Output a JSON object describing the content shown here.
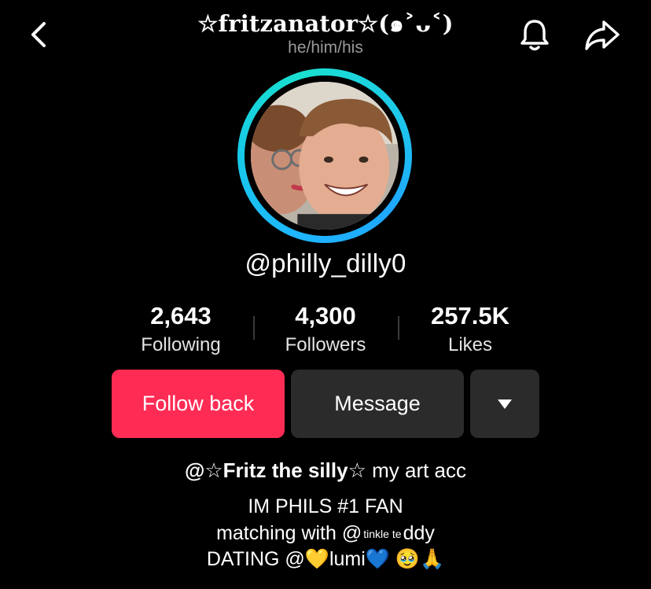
{
  "header": {
    "display_name": "☆fritzanator☆(๑˃ᴗ˂)",
    "pronouns": "he/him/his",
    "back_icon": "chevron-left-icon",
    "bell_icon": "bell-icon",
    "share_icon": "share-arrow-icon"
  },
  "profile": {
    "username": "@philly_dilly0",
    "avatar_ring_colors": [
      "#1fb6ff",
      "#19e0d0"
    ]
  },
  "stats": [
    {
      "value": "2,643",
      "label": "Following"
    },
    {
      "value": "4,300",
      "label": "Followers"
    },
    {
      "value": "257.5K",
      "label": "Likes"
    }
  ],
  "actions": {
    "follow_back": "Follow back",
    "message": "Message",
    "more_icon": "triangle-down-icon",
    "follow_color": "#fe2c55",
    "secondary_color": "#2b2b2b"
  },
  "bio": {
    "line1_mention": "@☆Fritz the silly☆",
    "line1_rest": " my art acc",
    "line2": "IM PHILS #1 FAN",
    "line3_prefix": "matching with @",
    "line3_tiny1": "tinkle",
    "line3_tiny2": "te",
    "line3_suffix": "ddy",
    "line4_prefix": "DATING @",
    "line4_heart1": "💛",
    "line4_name": "lumi",
    "line4_heart2": "💙",
    "line4_emojis": " 🥹🙏"
  }
}
